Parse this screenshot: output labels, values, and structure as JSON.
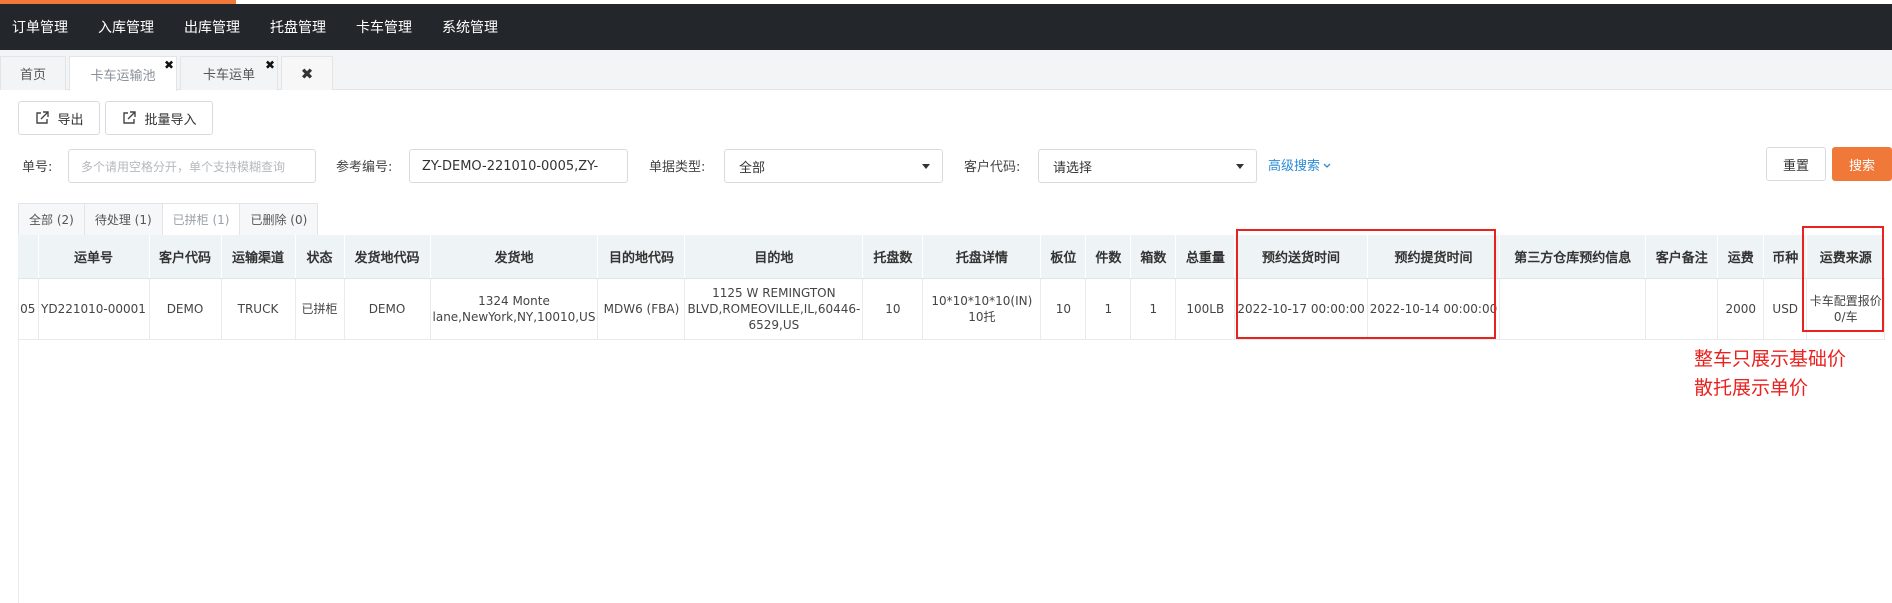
{
  "nav": {
    "items": [
      "订单管理",
      "入库管理",
      "出库管理",
      "托盘管理",
      "卡车管理",
      "系统管理"
    ]
  },
  "tabs": {
    "home": "首页",
    "truck_pool": "卡车运输池",
    "truck_order": "卡车运单",
    "close_glyph": "✖"
  },
  "toolbar": {
    "export": "导出",
    "bulk_import": "批量导入"
  },
  "filters": {
    "order_no_label": "单号:",
    "order_no_placeholder": "多个请用空格分开，单个支持模糊查询",
    "ref_label": "参考编号:",
    "ref_value": "ZY-DEMO-221010-0005,ZY-",
    "doc_type_label": "单据类型:",
    "doc_type_value": "全部",
    "customer_label": "客户代码:",
    "customer_value": "请选择",
    "advanced": "高级搜索",
    "reset": "重置",
    "search": "搜索"
  },
  "status_tabs": [
    "全部 (2)",
    "待处理 (1)",
    "已拼柜 (1)",
    "已删除 (0)"
  ],
  "table": {
    "headers": [
      "",
      "运单号",
      "客户代码",
      "运输渠道",
      "状态",
      "发货地代码",
      "发货地",
      "目的地代码",
      "目的地",
      "托盘数",
      "托盘详情",
      "板位",
      "件数",
      "箱数",
      "总重量",
      "预约送货时间",
      "预约提货时间",
      "第三方仓库预约信息",
      "客户备注",
      "运费",
      "币种",
      "运费来源"
    ],
    "rows": [
      [
        "05",
        "YD221010-00001",
        "DEMO",
        "TRUCK",
        "已拼柜",
        "DEMO",
        "1324 Monte lane,NewYork,NY,10010,US",
        "MDW6 (FBA)",
        "1125 W REMINGTON BLVD,ROMEOVILLE,IL,60446-6529,US",
        "10",
        "10*10*10*10(IN) 10托",
        "10",
        "1",
        "1",
        "100LB",
        "2022-10-17 00:00:00",
        "2022-10-14 00:00:00",
        "",
        "",
        "2000",
        "USD",
        "卡车配置报价 0/车"
      ]
    ]
  },
  "annotation": {
    "line1": "整车只展示基础价",
    "line2": "散托展示单价"
  },
  "colors": {
    "accent": "#f0793a",
    "nav_bg": "#23272b",
    "highlight": "#e8221f",
    "link": "#2d8cd6"
  }
}
